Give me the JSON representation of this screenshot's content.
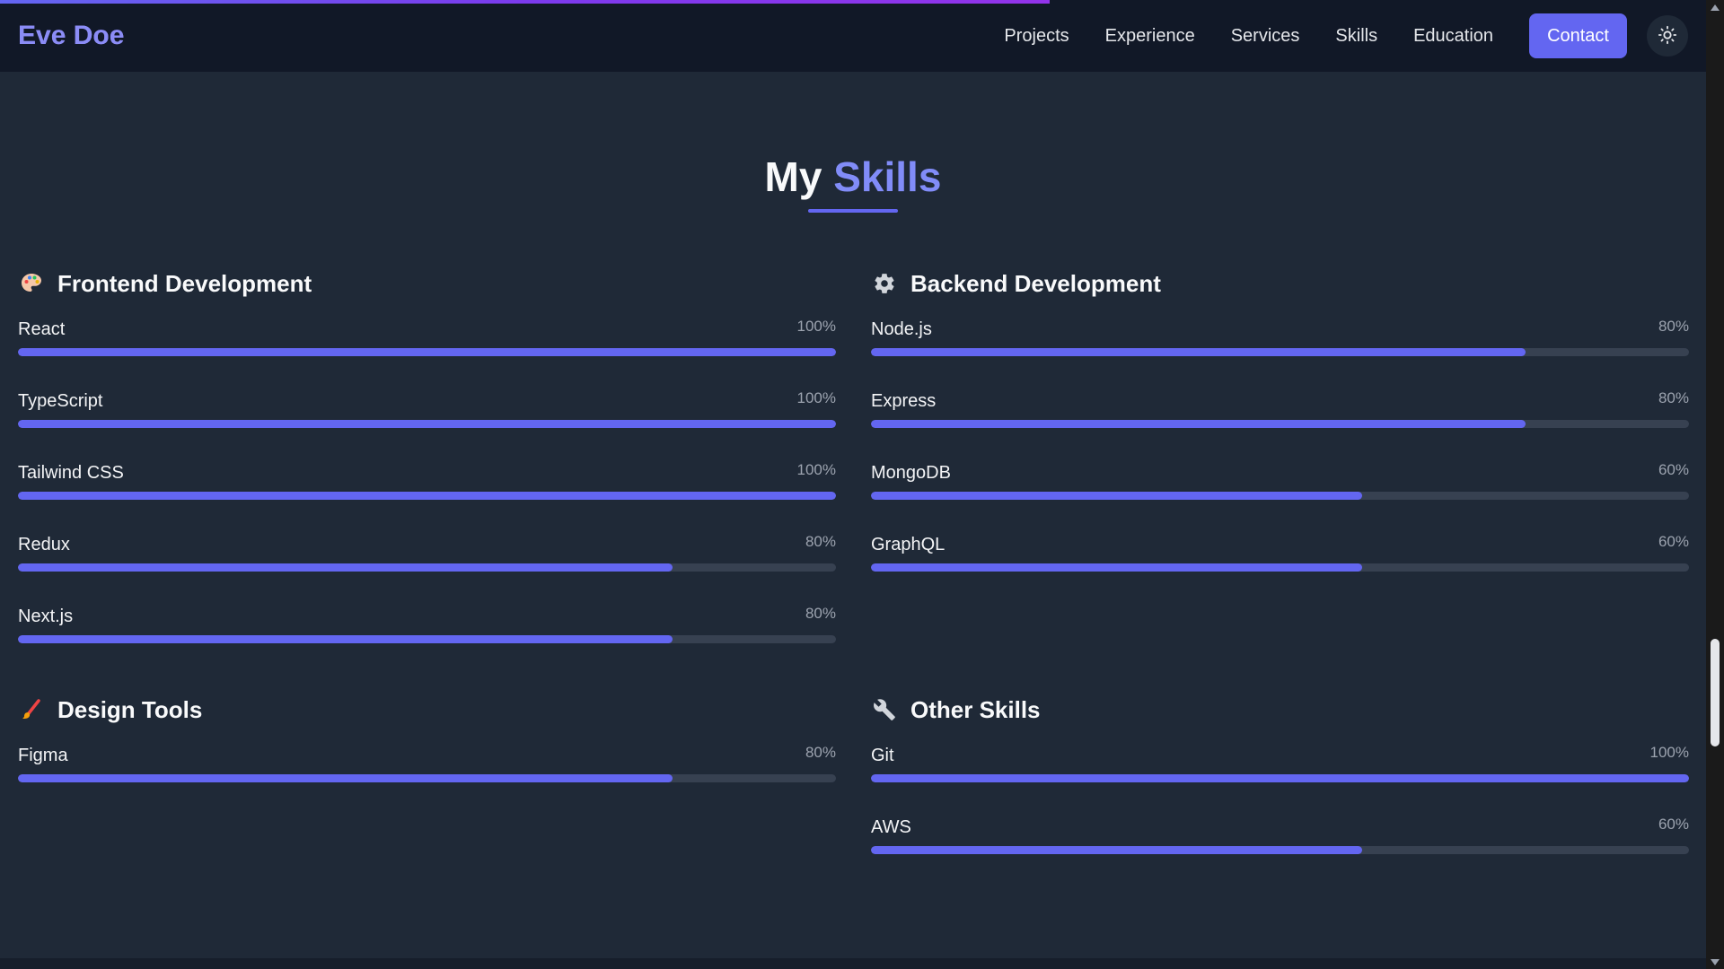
{
  "navbar": {
    "logo": "Eve Doe",
    "links": [
      "Projects",
      "Experience",
      "Services",
      "Skills",
      "Education"
    ],
    "contact_label": "Contact",
    "theme_icon": "sun-icon",
    "scroll_progress": 0.615
  },
  "skills_section": {
    "title_prefix": "My",
    "title_accent": "Skills",
    "groups": [
      {
        "id": "frontend",
        "icon": "palette-icon",
        "title": "Frontend Development",
        "skills": [
          {
            "name": "React",
            "percent_label": "100%",
            "level": 100
          },
          {
            "name": "TypeScript",
            "percent_label": "100%",
            "level": 100
          },
          {
            "name": "Tailwind CSS",
            "percent_label": "100%",
            "level": 100
          },
          {
            "name": "Redux",
            "percent_label": "80%",
            "level": 80
          },
          {
            "name": "Next.js",
            "percent_label": "80%",
            "level": 80
          }
        ]
      },
      {
        "id": "backend",
        "icon": "gear-icon",
        "title": "Backend Development",
        "skills": [
          {
            "name": "Node.js",
            "percent_label": "80%",
            "level": 80
          },
          {
            "name": "Express",
            "percent_label": "80%",
            "level": 80
          },
          {
            "name": "MongoDB",
            "percent_label": "60%",
            "level": 60
          },
          {
            "name": "GraphQL",
            "percent_label": "60%",
            "level": 60
          }
        ]
      },
      {
        "id": "design",
        "icon": "paintbrush-icon",
        "title": "Design Tools",
        "skills": [
          {
            "name": "Figma",
            "percent_label": "80%",
            "level": 80
          }
        ]
      },
      {
        "id": "other",
        "icon": "wrench-icon",
        "title": "Other Skills",
        "skills": [
          {
            "name": "Git",
            "percent_label": "100%",
            "level": 100
          },
          {
            "name": "AWS",
            "percent_label": "60%",
            "level": 60
          }
        ]
      }
    ]
  },
  "colors": {
    "accent": "#6366f1",
    "accent_text": "#818cf8",
    "background": "#1f2937",
    "navbar_bg": "#111827",
    "track": "#374151"
  }
}
